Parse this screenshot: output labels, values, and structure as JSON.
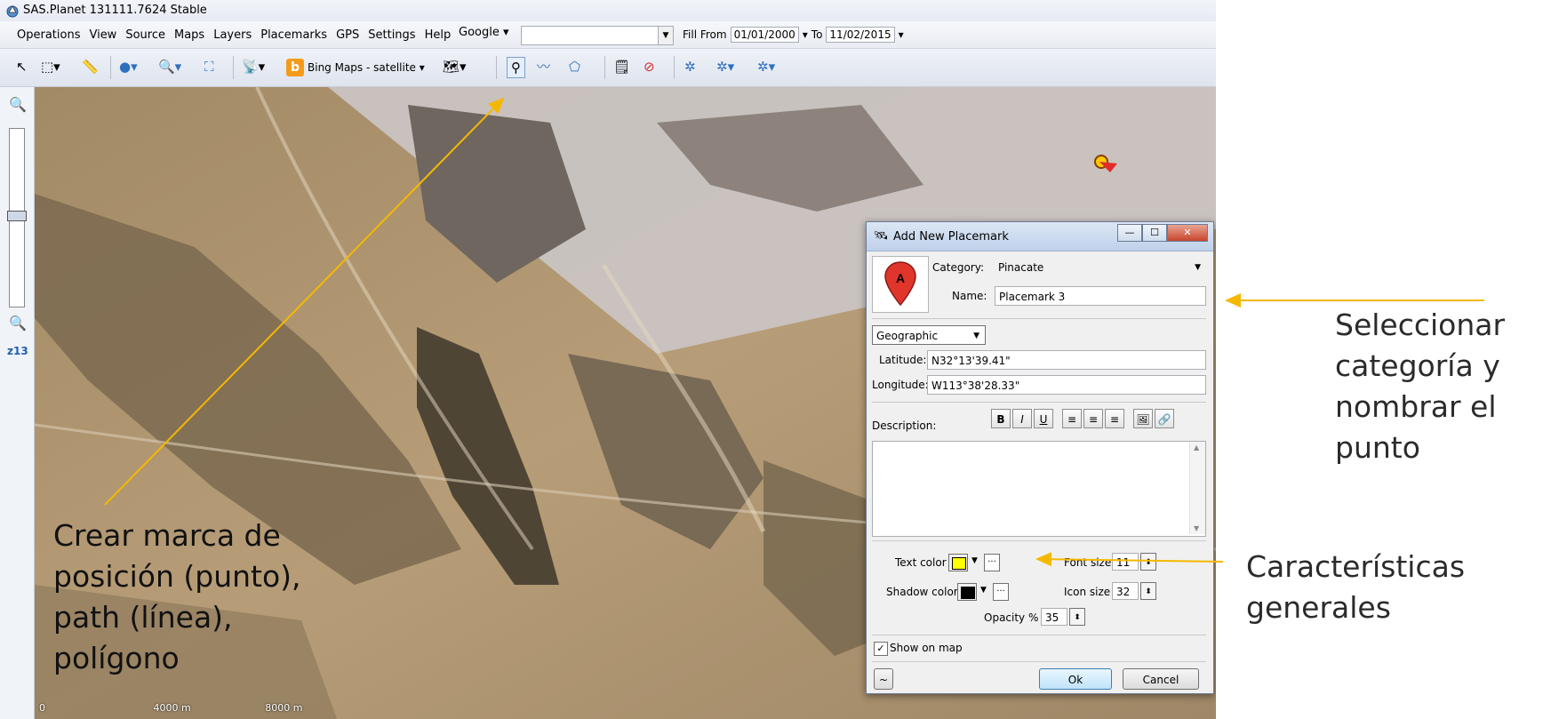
{
  "window": {
    "title": "SAS.Planet 131111.7624 Stable"
  },
  "menu": {
    "items": [
      "Operations",
      "View",
      "Source",
      "Maps",
      "Layers",
      "Placemarks",
      "GPS",
      "Settings",
      "Help"
    ],
    "source_select": "Google ▾",
    "fill_from_label": "Fill From",
    "fill_from": "01/01/2000",
    "to_label": "To",
    "to": "11/02/2015"
  },
  "toolbar": {
    "map_source": "Bing Maps - satellite ▾"
  },
  "zoom": {
    "level": "z13"
  },
  "scale": {
    "labels": [
      "0",
      "4000 m",
      "8000 m"
    ]
  },
  "dialog": {
    "title": "Add New Placemark",
    "category_label": "Category:",
    "category_value": "Pinacate",
    "name_label": "Name:",
    "name_value": "Placemark 3",
    "coord_system": "Geographic",
    "latitude_label": "Latitude:",
    "latitude_value": "N32°13'39.41\"",
    "longitude_label": "Longitude:",
    "longitude_value": "W113°38'28.33\"",
    "description_label": "Description:",
    "text_color_label": "Text color",
    "shadow_color_label": "Shadow color",
    "font_size_label": "Font size",
    "font_size_value": "11",
    "icon_size_label": "Icon size",
    "icon_size_value": "32",
    "opacity_label": "Opacity %",
    "opacity_value": "35",
    "show_on_map_label": "Show on map",
    "show_on_map_checked": true,
    "ok_label": "Ok",
    "cancel_label": "Cancel",
    "text_color": "#ffff00",
    "shadow_color": "#000000"
  },
  "annotations": {
    "right_top": [
      "Seleccionar",
      "categoría y",
      "nombrar el",
      "punto"
    ],
    "right_bottom": [
      "Características",
      "generales"
    ],
    "map_left": [
      "Crear marca de",
      "posición (punto),",
      "path (línea),",
      "polígono"
    ],
    "arrow_color": "#f5b800"
  }
}
